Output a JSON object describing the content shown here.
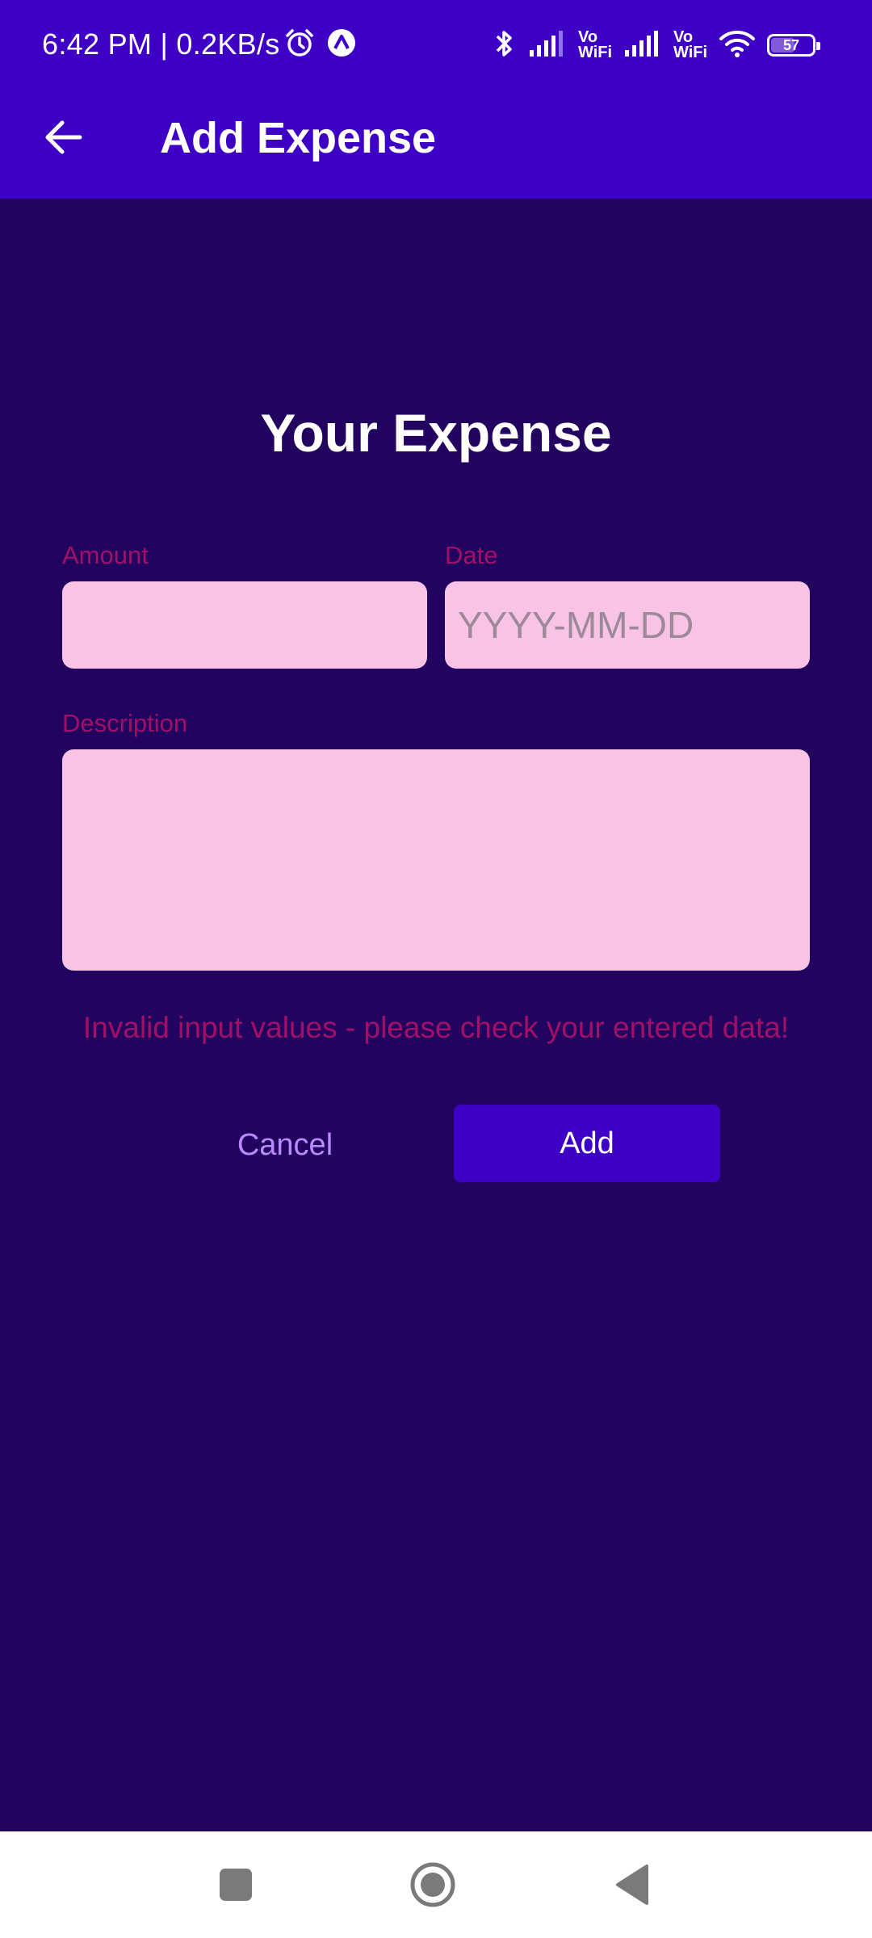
{
  "status_bar": {
    "time": "6:42 PM | 0.2KB/s",
    "vo1": "Vo",
    "wifi1": "WiFi",
    "vo2": "Vo",
    "wifi2": "WiFi",
    "battery": "57"
  },
  "app_bar": {
    "title": "Add Expense"
  },
  "form": {
    "heading": "Your Expense",
    "amount_label": "Amount",
    "amount_value": "",
    "date_label": "Date",
    "date_placeholder": "YYYY-MM-DD",
    "description_label": "Description",
    "description_value": "",
    "error": "Invalid input values - please check your entered data!",
    "cancel_label": "Cancel",
    "add_label": "Add"
  },
  "colors": {
    "app_bar": "#3f00c6",
    "background": "#22035f",
    "field_background": "#f9c3e5",
    "error_text": "#a20f66",
    "cancel_text": "#b88afc"
  },
  "icons": {
    "back": "arrow-left-icon",
    "alarm": "alarm-clock-icon",
    "app_status": "app-notification-icon",
    "bluetooth": "bluetooth-icon",
    "signal": "signal-icon",
    "wifi": "wifi-icon",
    "battery": "battery-icon",
    "nav_recents": "square-icon",
    "nav_home": "circle-icon",
    "nav_back": "triangle-back-icon"
  }
}
